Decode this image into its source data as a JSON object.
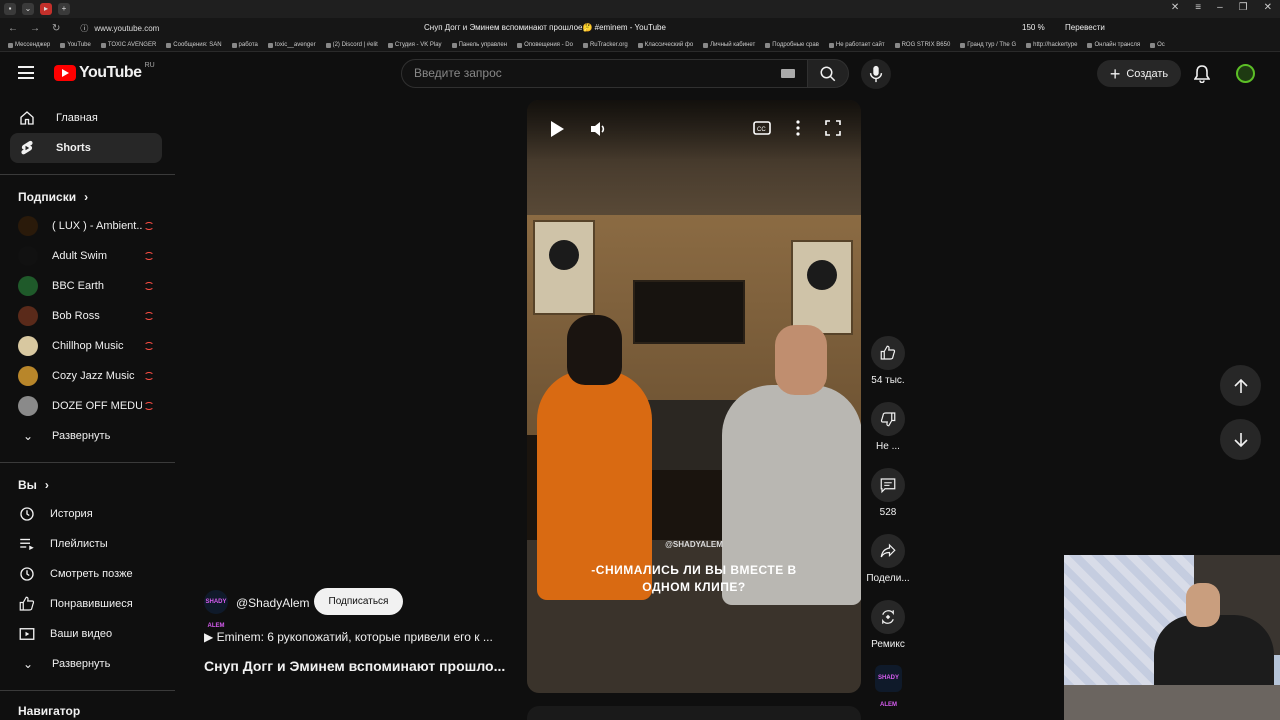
{
  "browser": {
    "url": "www.youtube.com",
    "page_title": "Снуп Догг и Эминем вспоминают прошлое🤔 #eminem - YouTube",
    "zoom": "150 %",
    "translate": "Перевести",
    "bookmarks": [
      "Мессенджер",
      "YouTube",
      "TOXIC AVENGER",
      "Сообщения: SAN",
      "работа",
      "toxic__avenger",
      "(2) Discord | #elit",
      "Студия - VK Play",
      "Панель управлен",
      "Оповещения - Do",
      "RuTracker.org",
      "Классический фо",
      "Личный кабинет",
      "Подробные срав",
      "Не работает сайт",
      "ROG STRIX B650",
      "Гранд тур / The G",
      "http://hackertype",
      "Онлайн трансля",
      "Ос"
    ]
  },
  "masthead": {
    "logo_text": "YouTube",
    "country_code": "RU",
    "search_placeholder": "Введите запрос",
    "create_label": "Создать"
  },
  "sidebar": {
    "primary": [
      {
        "label": "Главная",
        "icon": "home-icon"
      },
      {
        "label": "Shorts",
        "icon": "shorts-icon",
        "active": true
      }
    ],
    "subscriptions_title": "Подписки",
    "subscriptions": [
      {
        "name": "( LUX ) - Ambient...",
        "color": "#2a1a0a",
        "live": true
      },
      {
        "name": "Adult Swim",
        "color": "#111111",
        "live": true
      },
      {
        "name": "BBC Earth",
        "color": "#1f5a2a",
        "live": true
      },
      {
        "name": "Bob Ross",
        "color": "#5a2a1a",
        "live": true
      },
      {
        "name": "Chillhop Music",
        "color": "#d8c8a0",
        "live": true
      },
      {
        "name": "Cozy Jazz Music",
        "color": "#b8862a",
        "live": true
      },
      {
        "name": "DOZE OFF MEDU...",
        "color": "#8a8a8a",
        "live": true
      }
    ],
    "expand_label": "Развернуть",
    "you_title": "Вы",
    "you_items": [
      {
        "label": "История",
        "icon": "history-icon"
      },
      {
        "label": "Плейлисты",
        "icon": "playlists-icon"
      },
      {
        "label": "Смотреть позже",
        "icon": "watch-later-icon"
      },
      {
        "label": "Понравившиеся",
        "icon": "like-icon"
      },
      {
        "label": "Ваши видео",
        "icon": "your-videos-icon"
      }
    ],
    "expand_label_2": "Развернуть",
    "navigator_title": "Навигатор"
  },
  "video": {
    "watermark": "@SHADYALEM",
    "caption": "-СНИМАЛИСЬ ЛИ ВЫ ВМЕСТЕ В ОДНОМ КЛИПЕ?"
  },
  "meta": {
    "channel_avatar_text": "SHADY ALEM",
    "channel": "@ShadyAlem",
    "subscribe": "Подписаться",
    "playlist": "▶  Eminem: 6 рукопожатий, которые привели его к ...",
    "title": "Снуп Догг и Эминем вспоминают прошло..."
  },
  "actions": {
    "likes": "54 тыс.",
    "dislike": "Не ...",
    "comments": "528",
    "share": "Подели...",
    "remix": "Ремикс"
  },
  "colors": {
    "background": "#0f0f0f",
    "accent": "#ff0000",
    "chip": "#272727"
  }
}
